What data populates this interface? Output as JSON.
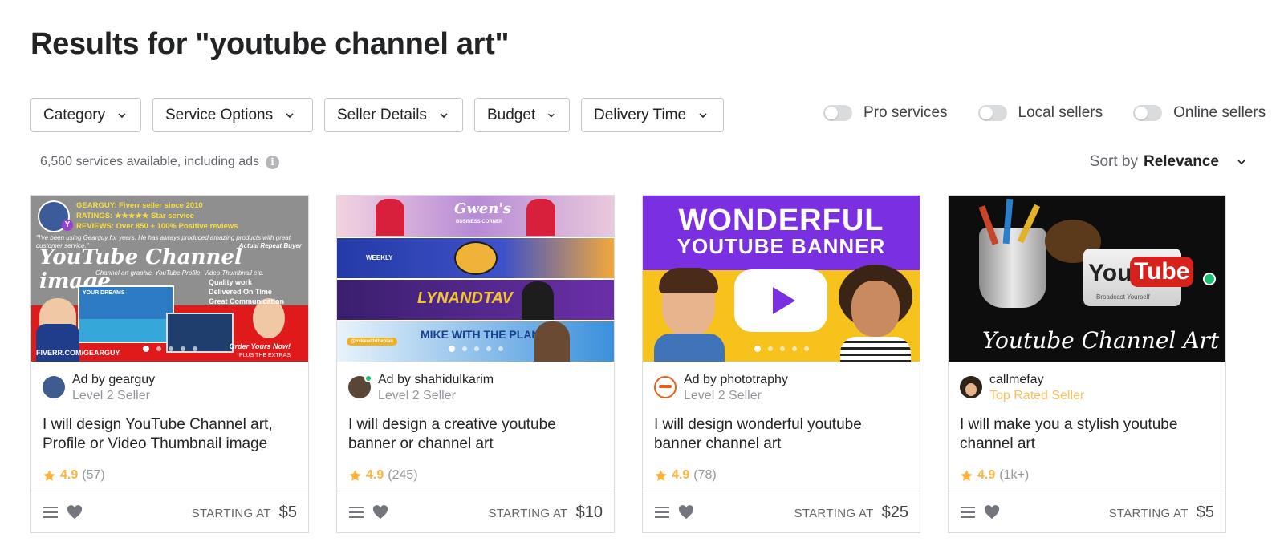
{
  "search": {
    "heading": "Results for \"youtube channel art\""
  },
  "filters": [
    {
      "label": "Category"
    },
    {
      "label": "Service Options"
    },
    {
      "label": "Seller Details"
    },
    {
      "label": "Budget"
    },
    {
      "label": "Delivery Time"
    }
  ],
  "toggles": [
    {
      "label": "Pro services",
      "on": false
    },
    {
      "label": "Local sellers",
      "on": false
    },
    {
      "label": "Online sellers",
      "on": false
    }
  ],
  "results": {
    "count_text": "6,560 services available, including ads"
  },
  "sort": {
    "label": "Sort by",
    "value": "Relevance"
  },
  "cards": [
    {
      "seller": "Ad by gearguy",
      "level": "Level 2 Seller",
      "title": "I will design YouTube Channel art, Profile or Video Thumbnail image",
      "rating": "4.9",
      "reviews": "(57)",
      "price_label": "STARTING AT",
      "price": "$5",
      "thumb": {
        "line1": "GEARGUY: Fiverr seller since 2010",
        "line2": "RATINGS: ★★★★★ Star service",
        "line3": "REVIEWS: Over 850 + 100% Positive reviews",
        "quote": "\"I've been using Gearguy for years. He has always produced amazing products with great customer service.\"",
        "byline": "Actual Repeat Buyer",
        "headline": "YouTube Channel image",
        "sub": "Channel art graphic, YouTube Profile, Video Thumbnail etc.",
        "bullets": [
          "Quality work",
          "Delivered On Time",
          "Great Communication"
        ],
        "url": "FIVERR.COM/GEARGUY",
        "order": "Order Yours Now!",
        "extras": "*PLUS THE EXTRAS",
        "dream": "YOUR DREAMS",
        "badge": "Y"
      }
    },
    {
      "seller": "Ad by shahidulkarim",
      "level": "Level 2 Seller",
      "title": "I will design a creative youtube banner or channel art",
      "rating": "4.9",
      "reviews": "(245)",
      "price_label": "STARTING AT",
      "price": "$10",
      "thumb": {
        "b1": "Gwen's",
        "b1sub": "BUSINESS CORNER",
        "b2": "WEEKLY",
        "b3": "LYNANDTAV",
        "b4": "MIKE WITH THE PLAN",
        "b4sub": "@mikewiththeplan"
      }
    },
    {
      "seller": "Ad by phototraphy",
      "level": "Level 2 Seller",
      "title": "I will design wonderful youtube banner channel art",
      "rating": "4.9",
      "reviews": "(78)",
      "price_label": "STARTING AT",
      "price": "$25",
      "thumb": {
        "l1": "WONDERFUL",
        "l2": "YOUTUBE BANNER"
      }
    },
    {
      "seller": "callmefay",
      "level": "Top Rated Seller",
      "title": "I will make you a stylish youtube channel art",
      "rating": "4.9",
      "reviews": "(1k+)",
      "price_label": "STARTING AT",
      "price": "$5",
      "thumb": {
        "logo1": "You",
        "logo2": "Tube",
        "tag": "Broadcast Yourself",
        "script": "Youtube Channel Art"
      }
    }
  ],
  "colors": {
    "star": "#ffb33e",
    "top_rated": "#ffbe5b",
    "border": "#dadbdd",
    "text": "#222325",
    "muted": "#95979d"
  }
}
